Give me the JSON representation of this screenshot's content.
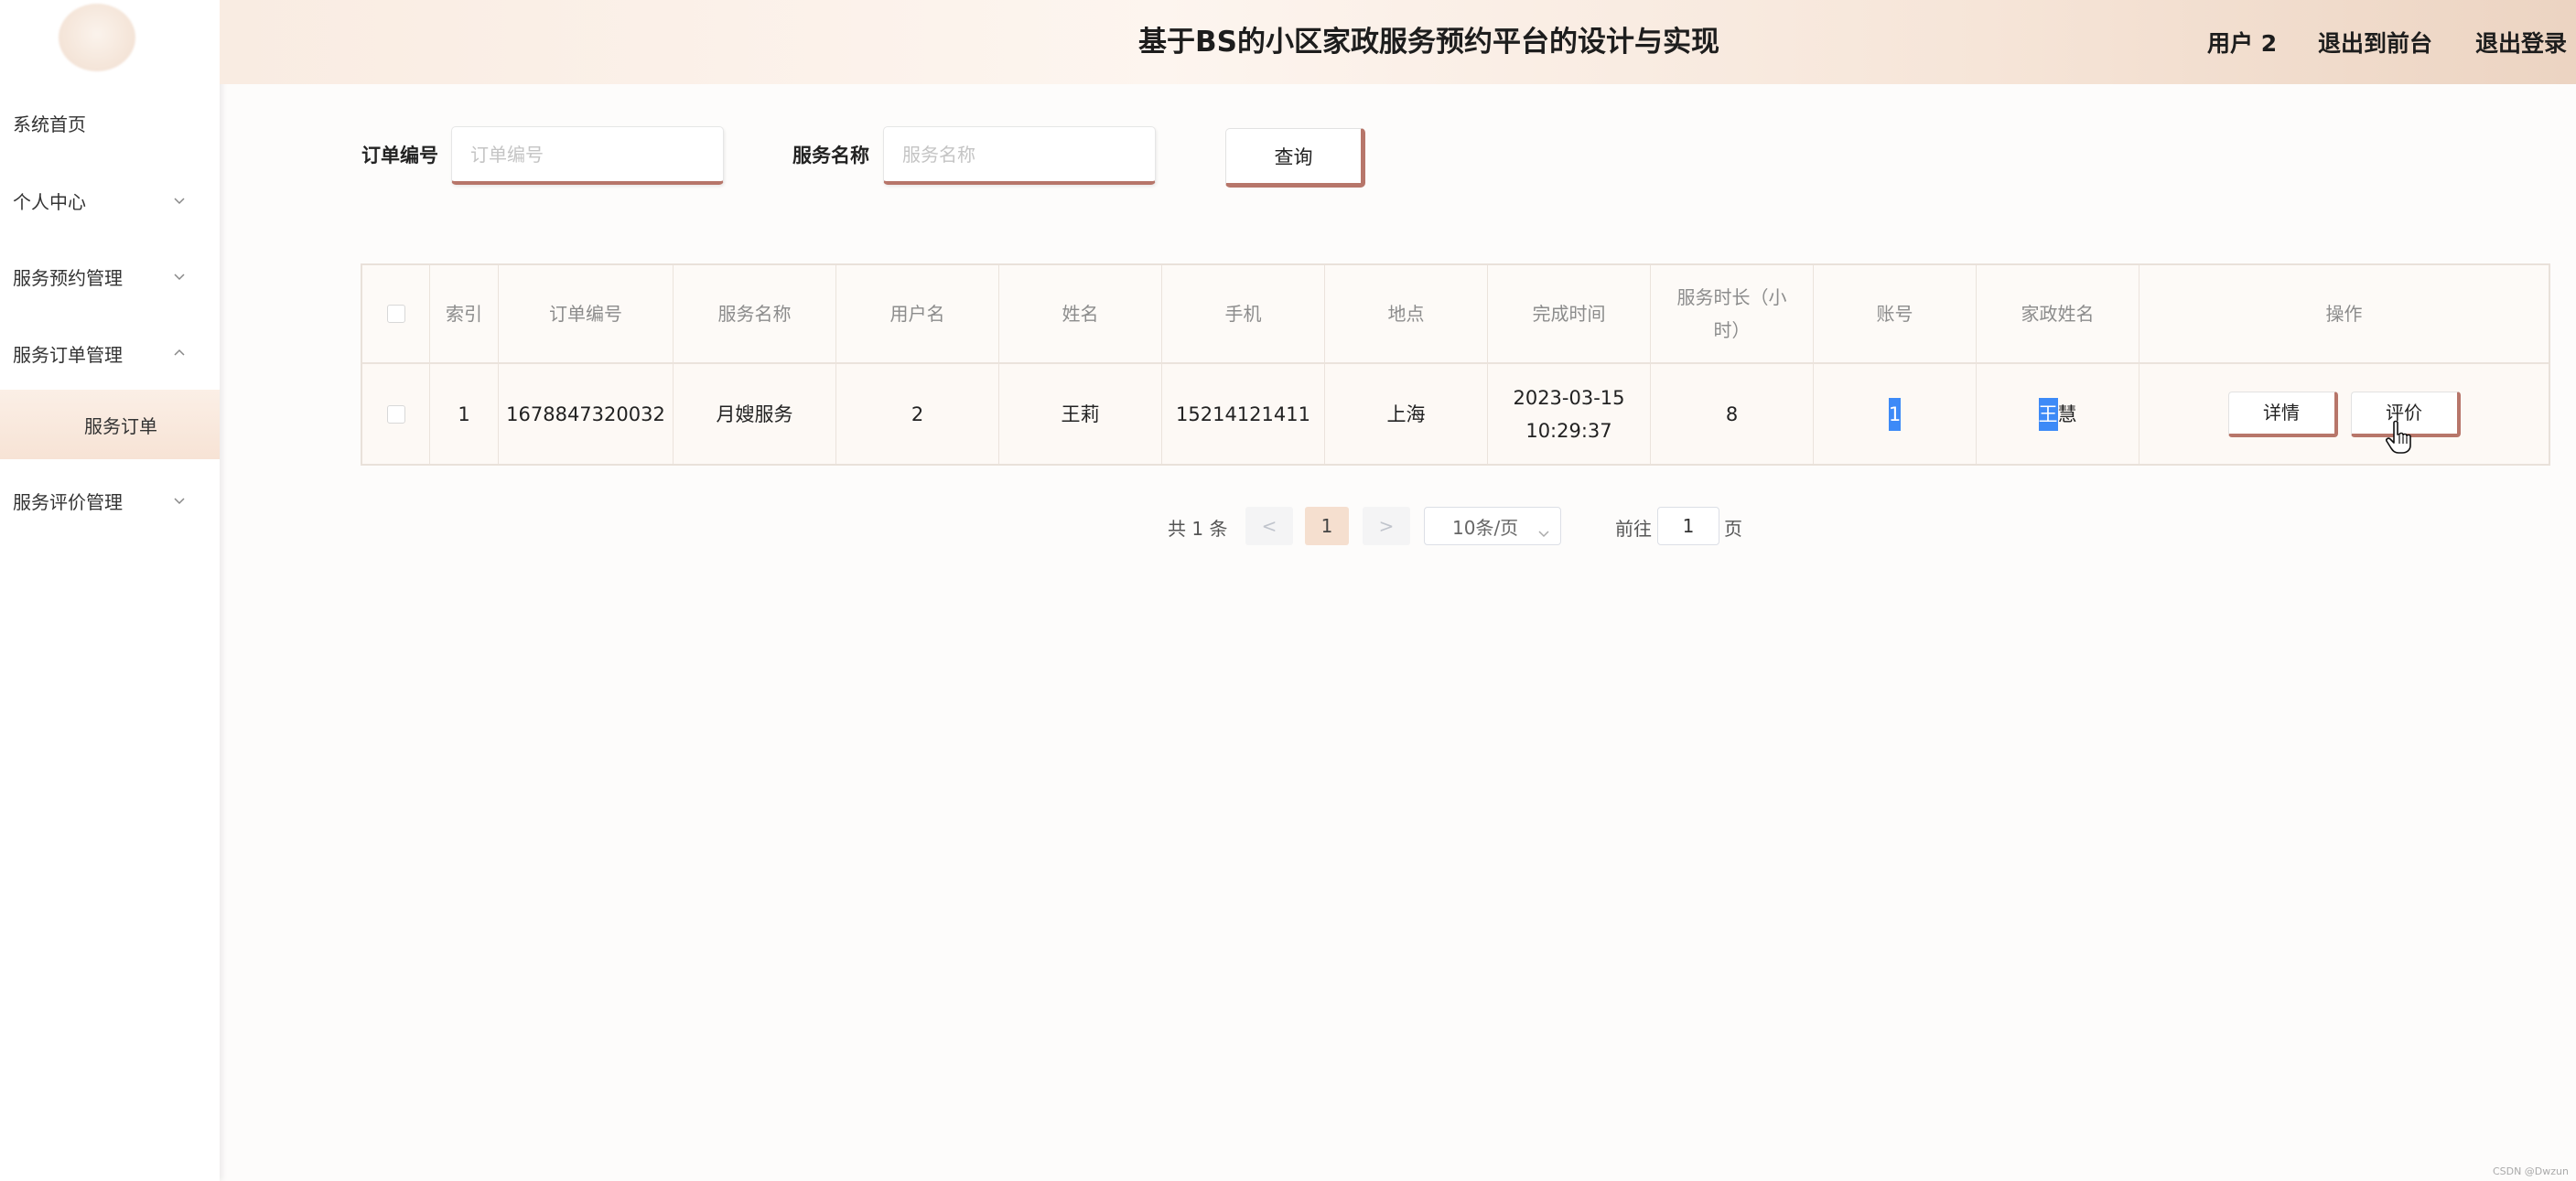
{
  "header": {
    "title": "基于BS的小区家政服务预约平台的设计与实现",
    "user_label": "用户 2",
    "back_to_front": "退出到前台",
    "logout": "退出登录"
  },
  "sidebar": {
    "items": [
      {
        "label": "系统首页"
      },
      {
        "label": "个人中心"
      },
      {
        "label": "服务预约管理"
      },
      {
        "label": "服务订单管理"
      },
      {
        "label": "服务评价管理"
      }
    ],
    "subitem": {
      "label": "服务订单"
    }
  },
  "search": {
    "order_label": "订单编号",
    "order_placeholder": "订单编号",
    "service_label": "服务名称",
    "service_placeholder": "服务名称",
    "query_button": "查询"
  },
  "table": {
    "headers": [
      "索引",
      "订单编号",
      "服务名称",
      "用户名",
      "姓名",
      "手机",
      "地点",
      "完成时间",
      "服务时长（小时）",
      "账号",
      "家政姓名",
      "操作"
    ],
    "rows": [
      {
        "index": "1",
        "order_no": "1678847320032",
        "service": "月嫂服务",
        "username": "2",
        "name": "王莉",
        "phone": "15214121411",
        "location": "上海",
        "finish_time": "2023-03-15 10:29:37",
        "duration": "8",
        "account": "1",
        "staff_name_first": "王",
        "staff_name_rest": "慧",
        "detail_button": "详情",
        "review_button": "评价"
      }
    ]
  },
  "pagination": {
    "total": "共 1 条",
    "prev": "<",
    "current_page": "1",
    "next": ">",
    "page_size": "10条/页",
    "goto_label": "前往",
    "goto_value": "1",
    "page_suffix": "页"
  },
  "watermark": "CSDN @Dwzun",
  "colors": {
    "accent": "#b7766a",
    "highlight": "#3d8af7",
    "active_page": "#f5dfcf"
  }
}
